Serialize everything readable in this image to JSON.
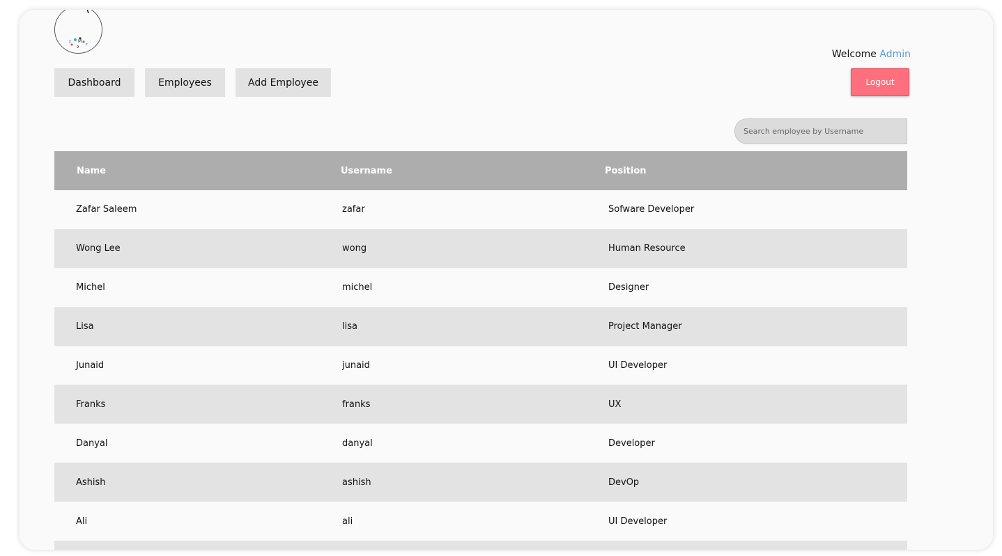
{
  "header": {
    "welcome_text": "Welcome",
    "user_name": "Admin",
    "logout_label": "Logout"
  },
  "nav": {
    "dashboard": "Dashboard",
    "employees": "Employees",
    "add_employee": "Add Employee"
  },
  "search": {
    "placeholder": "Search employee by Username",
    "value": ""
  },
  "table": {
    "columns": [
      "Name",
      "Username",
      "Position"
    ],
    "rows": [
      {
        "name": "Zafar Saleem",
        "username": "zafar",
        "position": "Sofware Developer"
      },
      {
        "name": "Wong Lee",
        "username": "wong",
        "position": "Human Resource"
      },
      {
        "name": "Michel",
        "username": "michel",
        "position": "Designer"
      },
      {
        "name": "Lisa",
        "username": "lisa",
        "position": "Project Manager"
      },
      {
        "name": "Junaid",
        "username": "junaid",
        "position": "UI Developer"
      },
      {
        "name": "Franks",
        "username": "franks",
        "position": "UX"
      },
      {
        "name": "Danyal",
        "username": "danyal",
        "position": "Developer"
      },
      {
        "name": "Ashish",
        "username": "ashish",
        "position": "DevOp"
      },
      {
        "name": "Ali",
        "username": "ali",
        "position": "UI Developer"
      },
      {
        "name": "",
        "username": "",
        "position": ""
      }
    ]
  },
  "colors": {
    "header_bg": "#adadad",
    "row_alt_bg": "#e3e3e3",
    "logout_bg": "#ff6f7d",
    "accent": "#5b9bd5"
  }
}
